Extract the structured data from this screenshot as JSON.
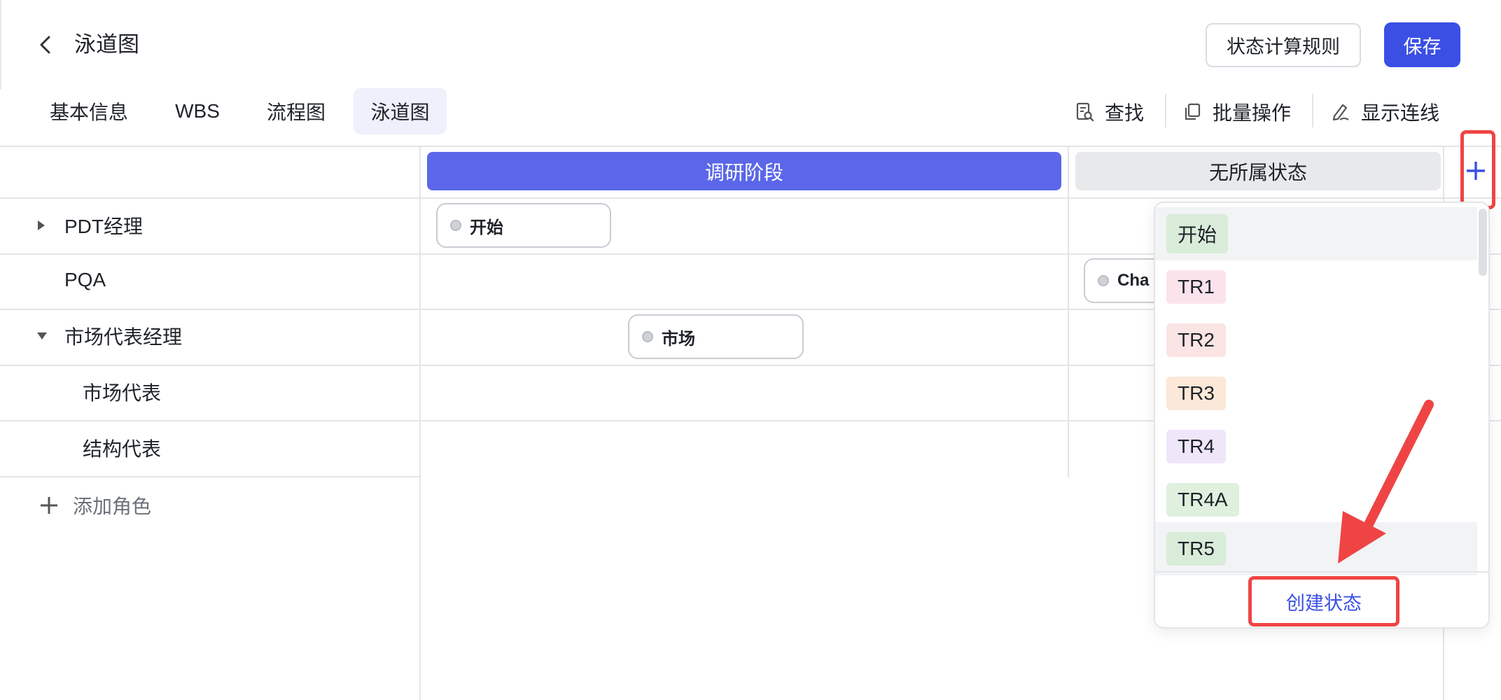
{
  "header": {
    "title": "泳道图",
    "rules_button": "状态计算规则",
    "save_button": "保存"
  },
  "tabs": [
    {
      "label": "基本信息",
      "active": false
    },
    {
      "label": "WBS",
      "active": false
    },
    {
      "label": "流程图",
      "active": false
    },
    {
      "label": "泳道图",
      "active": true
    }
  ],
  "toolbar": {
    "find": "查找",
    "batch": "批量操作",
    "show_lines": "显示连线"
  },
  "lanes": [
    {
      "label": "调研阶段",
      "color": "#5b67e8"
    },
    {
      "label": "无所属状态",
      "color": "#e8e9eb"
    }
  ],
  "roles": [
    {
      "label": "PDT经理",
      "expander": "right"
    },
    {
      "label": "PQA",
      "expander": "none"
    },
    {
      "label": "市场代表经理",
      "expander": "down"
    },
    {
      "label": "市场代表",
      "expander": "none"
    },
    {
      "label": "结构代表",
      "expander": "none"
    }
  ],
  "add_role": "添加角色",
  "nodes": [
    {
      "label": "开始"
    },
    {
      "label": "Cha"
    },
    {
      "label": "市场"
    }
  ],
  "dropdown": {
    "options": [
      {
        "label": "开始",
        "bg": "#d9ecd9",
        "fg": "#1f2329"
      },
      {
        "label": "TR1",
        "bg": "#fbe3ec",
        "fg": "#1f2329"
      },
      {
        "label": "TR2",
        "bg": "#fbe4e4",
        "fg": "#1f2329"
      },
      {
        "label": "TR3",
        "bg": "#fbe8d8",
        "fg": "#1f2329"
      },
      {
        "label": "TR4",
        "bg": "#efe6fa",
        "fg": "#1f2329"
      },
      {
        "label": "TR4A",
        "bg": "#dff0df",
        "fg": "#1f2329"
      },
      {
        "label": "TR5",
        "bg": "#d9ecd9",
        "fg": "#1f2329"
      }
    ],
    "create_label": "创建状态"
  },
  "colors": {
    "primary": "#3b4fe4",
    "annotation": "#ef4444"
  }
}
